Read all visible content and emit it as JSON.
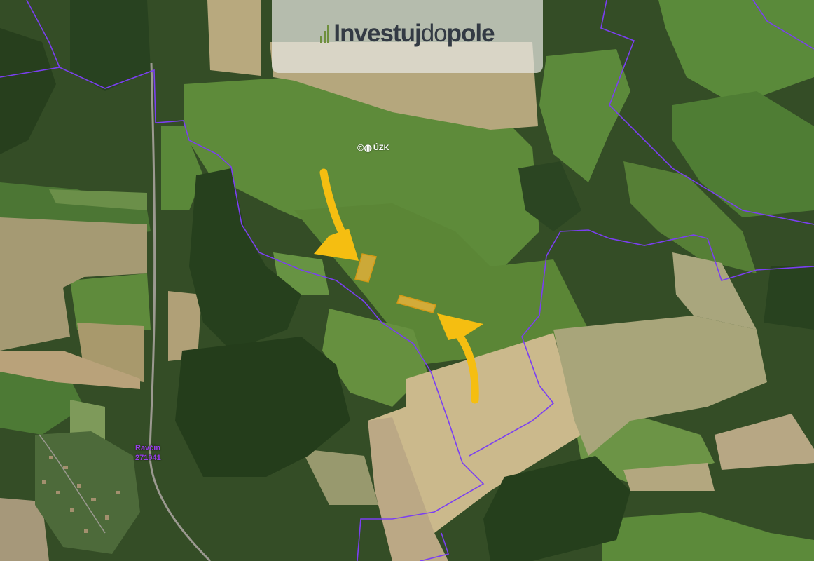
{
  "logo": {
    "part1": "Investuj",
    "part2": "do",
    "part3": "pole"
  },
  "watermark": {
    "text": "ÚZK",
    "icon": "copyright-globe-icon"
  },
  "place_label": {
    "line1": "Ravčin",
    "line2": "271041"
  },
  "colors": {
    "boundary": "#7b3ff2",
    "parcel_fill": "#e8b23a",
    "arrow": "#f5be11",
    "forest": "#2f4a22",
    "meadow": "#5f8c3d",
    "field": "#b9ab7d"
  }
}
